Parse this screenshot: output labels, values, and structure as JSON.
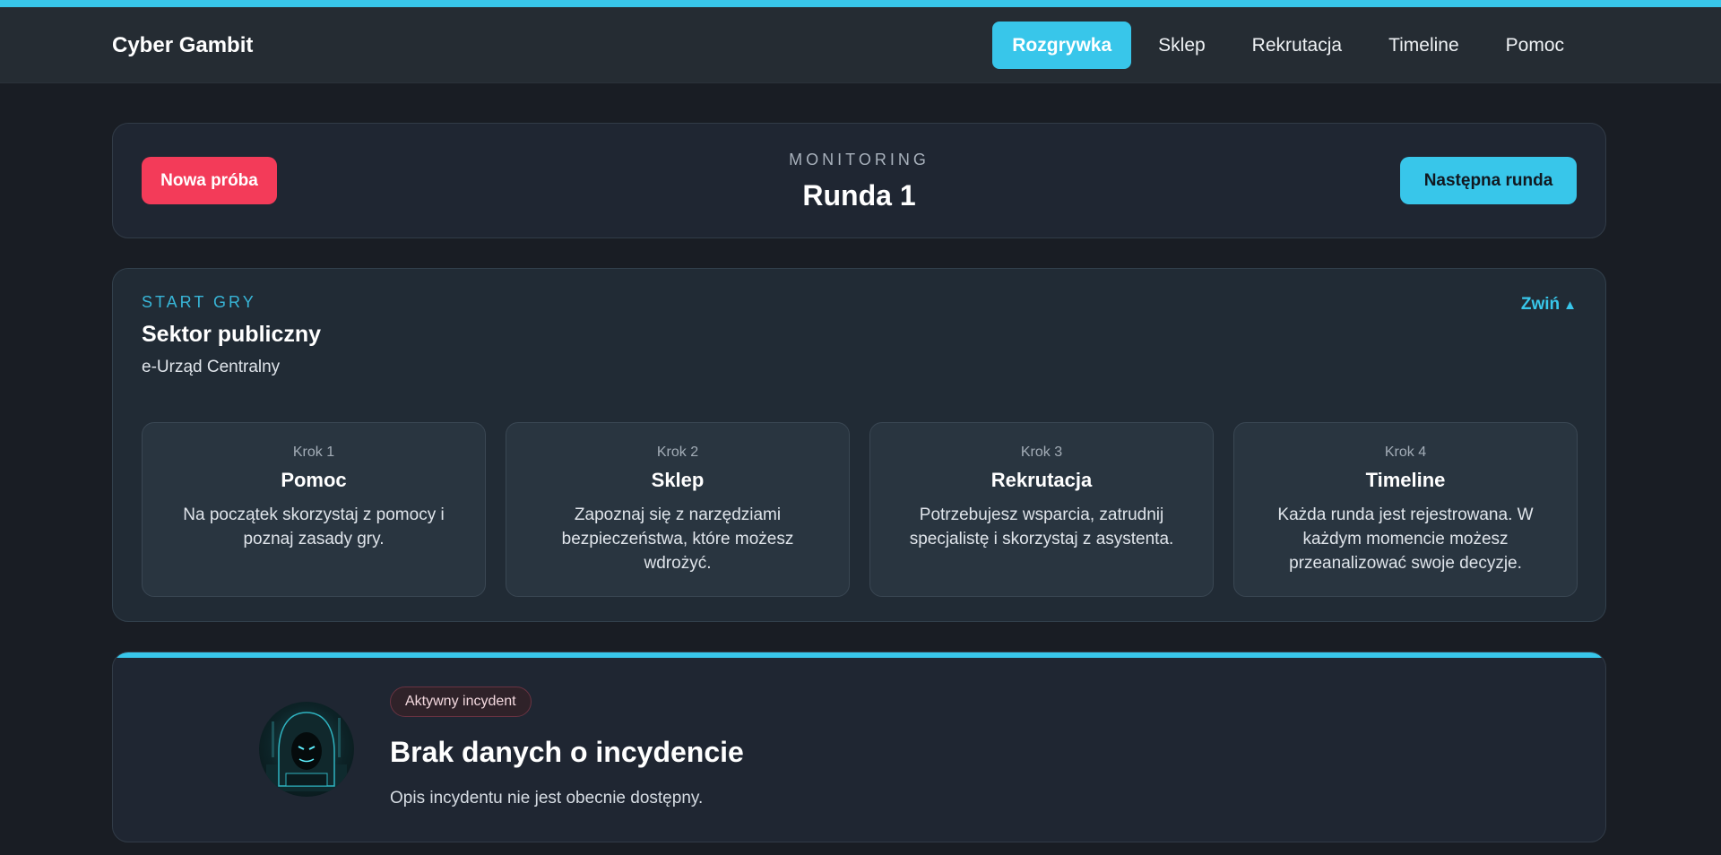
{
  "app": {
    "brand": "Cyber Gambit",
    "accent": "#38c6ea",
    "danger": "#f33b59"
  },
  "nav": {
    "items": [
      {
        "label": "Rozgrywka",
        "active": true
      },
      {
        "label": "Sklep",
        "active": false
      },
      {
        "label": "Rekrutacja",
        "active": false
      },
      {
        "label": "Timeline",
        "active": false
      },
      {
        "label": "Pomoc",
        "active": false
      }
    ]
  },
  "monitor": {
    "eyebrow": "MONITORING",
    "round": "Runda 1",
    "retry_label": "Nowa próba",
    "next_label": "Następna runda"
  },
  "start": {
    "eyebrow": "START GRY",
    "sector": "Sektor publiczny",
    "organization": "e-Urząd Centralny",
    "collapse_label": "Zwiń",
    "collapse_icon": "triangle-up-icon",
    "steps": [
      {
        "num": "Krok 1",
        "title": "Pomoc",
        "desc": "Na początek skorzystaj z pomocy i poznaj zasady gry."
      },
      {
        "num": "Krok 2",
        "title": "Sklep",
        "desc": "Zapoznaj się z narzędziami bezpieczeństwa, które możesz wdrożyć."
      },
      {
        "num": "Krok 3",
        "title": "Rekrutacja",
        "desc": "Potrzebujesz wsparcia, zatrudnij specjalistę i skorzystaj z asystenta."
      },
      {
        "num": "Krok 4",
        "title": "Timeline",
        "desc": "Każda runda jest rejestrowana. W każdym momencie możesz przeanalizować swoje decyzje."
      }
    ]
  },
  "incident": {
    "badge": "Aktywny incydent",
    "title": "Brak danych o incydencie",
    "description": "Opis incydentu nie jest obecnie dostępny.",
    "avatar_icon": "hooded-hacker-avatar"
  }
}
